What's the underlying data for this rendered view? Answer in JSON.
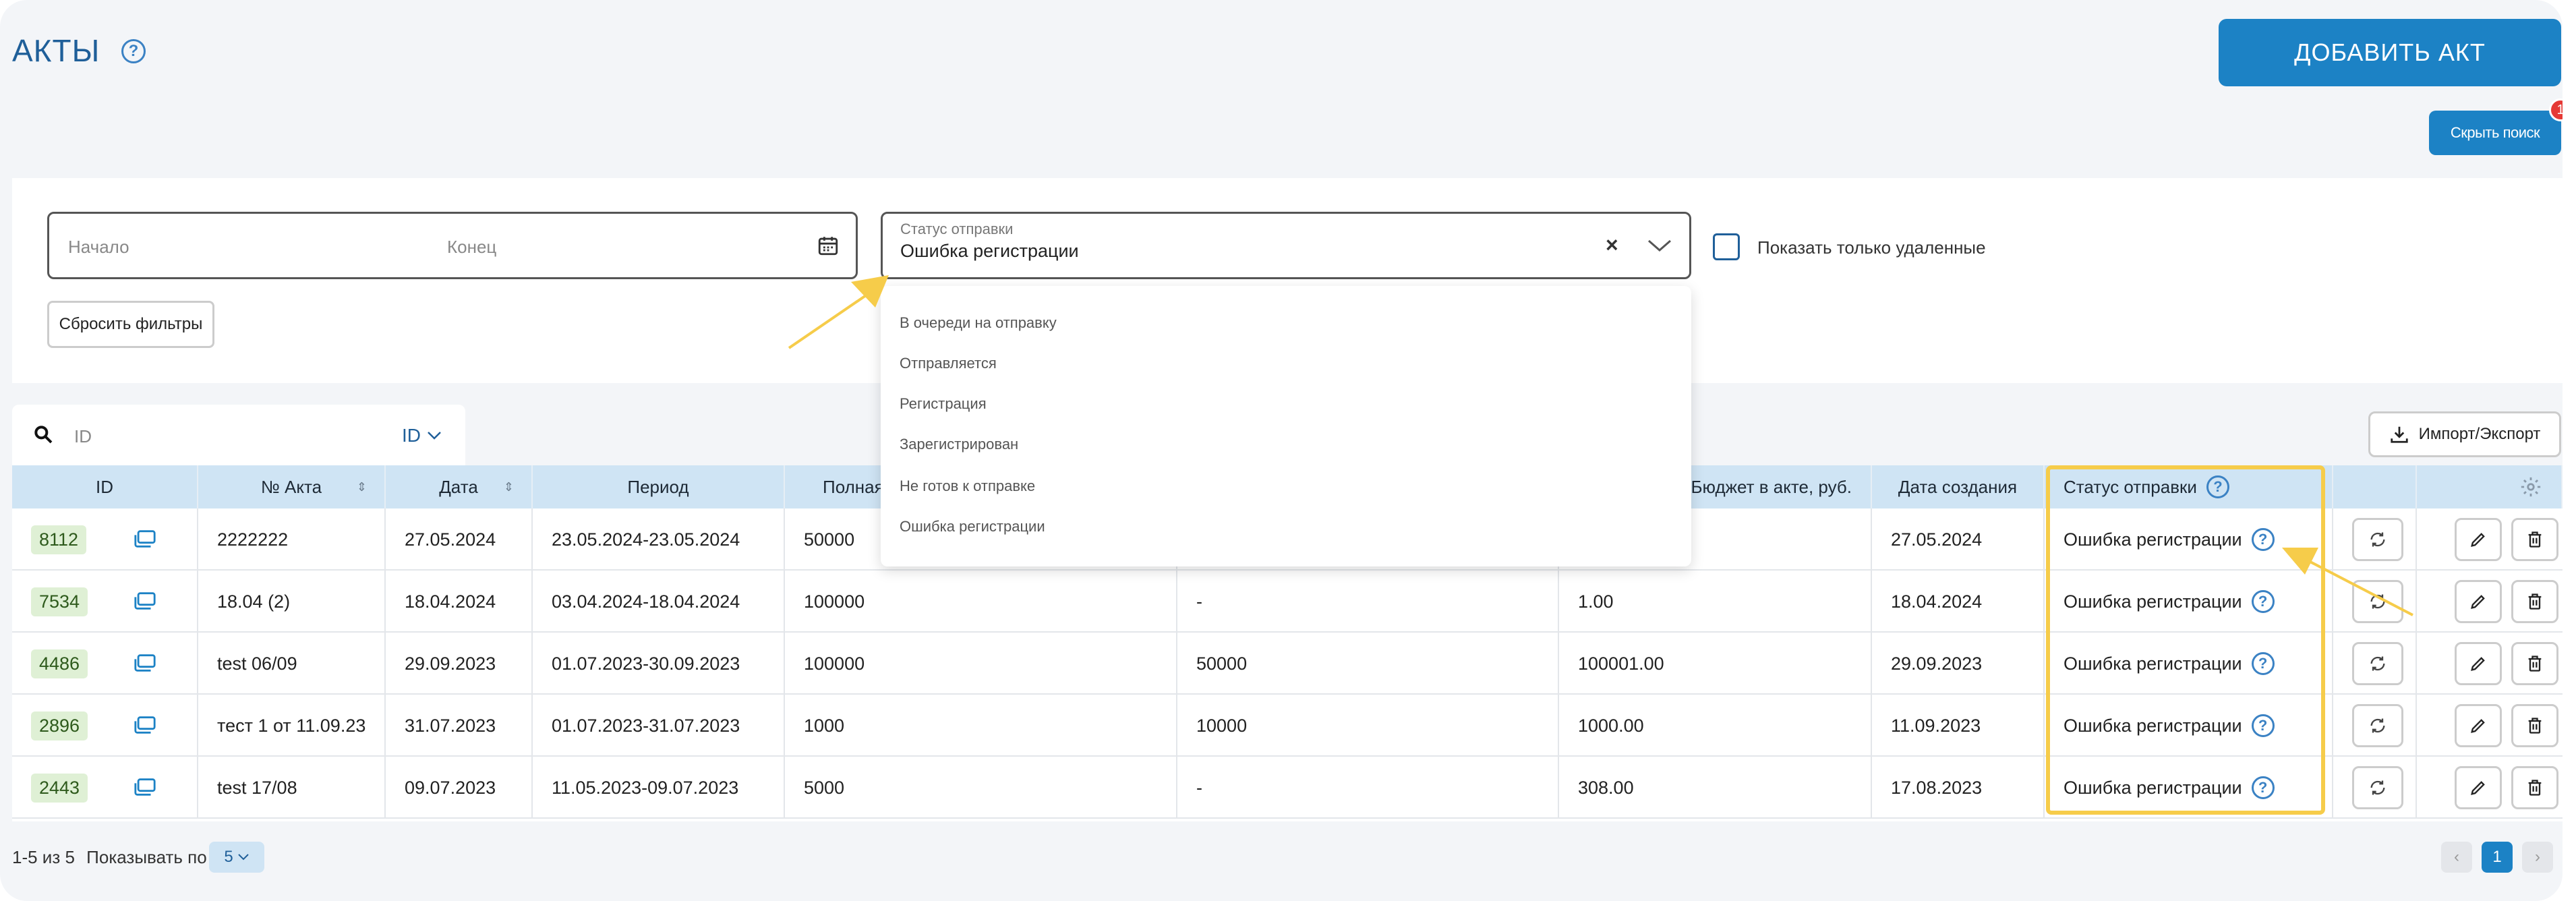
{
  "header": {
    "title": "АКТЫ",
    "add_button": "ДОБАВИТЬ АКТ",
    "hide_search_button": "Скрыть поиск",
    "notification_count": "1"
  },
  "filters": {
    "date_start_placeholder": "Начало",
    "date_end_placeholder": "Конец",
    "status_caption": "Статус отправки",
    "status_value": "Ошибка регистрации",
    "show_deleted_label": "Показать только удаленные",
    "reset_button": "Сбросить фильтры",
    "status_options": [
      "В очереди на отправку",
      "Отправляется",
      "Регистрация",
      "Зарегистрирован",
      "Не готов к отправке",
      "Ошибка регистрации"
    ]
  },
  "search": {
    "placeholder": "ID",
    "field_selector": "ID"
  },
  "import_export_button": "Импорт/Экспорт",
  "table": {
    "columns": [
      "ID",
      "№ Акта",
      "Дата",
      "Период",
      "Полная",
      "",
      "Бюджет в акте, руб.",
      "Дата создания",
      "Статус отправки",
      "",
      ""
    ],
    "rows": [
      {
        "id": "8112",
        "number": "2222222",
        "date": "27.05.2024",
        "period": "23.05.2024-23.05.2024",
        "full": "50000",
        "col6": "",
        "budget": "",
        "created": "27.05.2024",
        "status": "Ошибка регистрации"
      },
      {
        "id": "7534",
        "number": "18.04 (2)",
        "date": "18.04.2024",
        "period": "03.04.2024-18.04.2024",
        "full": "100000",
        "col6": "-",
        "budget": "1.00",
        "created": "18.04.2024",
        "status": "Ошибка регистрации"
      },
      {
        "id": "4486",
        "number": "test 06/09",
        "date": "29.09.2023",
        "period": "01.07.2023-30.09.2023",
        "full": "100000",
        "col6": "50000",
        "budget": "100001.00",
        "created": "29.09.2023",
        "status": "Ошибка регистрации"
      },
      {
        "id": "2896",
        "number": "тест 1 от 11.09.23",
        "date": "31.07.2023",
        "period": "01.07.2023-31.07.2023",
        "full": "1000",
        "col6": "10000",
        "budget": "1000.00",
        "created": "11.09.2023",
        "status": "Ошибка регистрации"
      },
      {
        "id": "2443",
        "number": "test 17/08",
        "date": "09.07.2023",
        "period": "11.05.2023-09.07.2023",
        "full": "5000",
        "col6": "-",
        "budget": "308.00",
        "created": "17.08.2023",
        "status": "Ошибка регистрации"
      }
    ]
  },
  "pagination": {
    "info": "1-5 из 5",
    "per_page_label": "Показывать по",
    "per_page_value": "5",
    "current_page": "1"
  },
  "colors": {
    "primary": "#1c82c5",
    "title": "#1f5f99",
    "header_row": "#cfe4f4",
    "highlight": "#f6cc4a",
    "arrow": "#f6cc4a",
    "id_badge": "#dff0d5"
  }
}
